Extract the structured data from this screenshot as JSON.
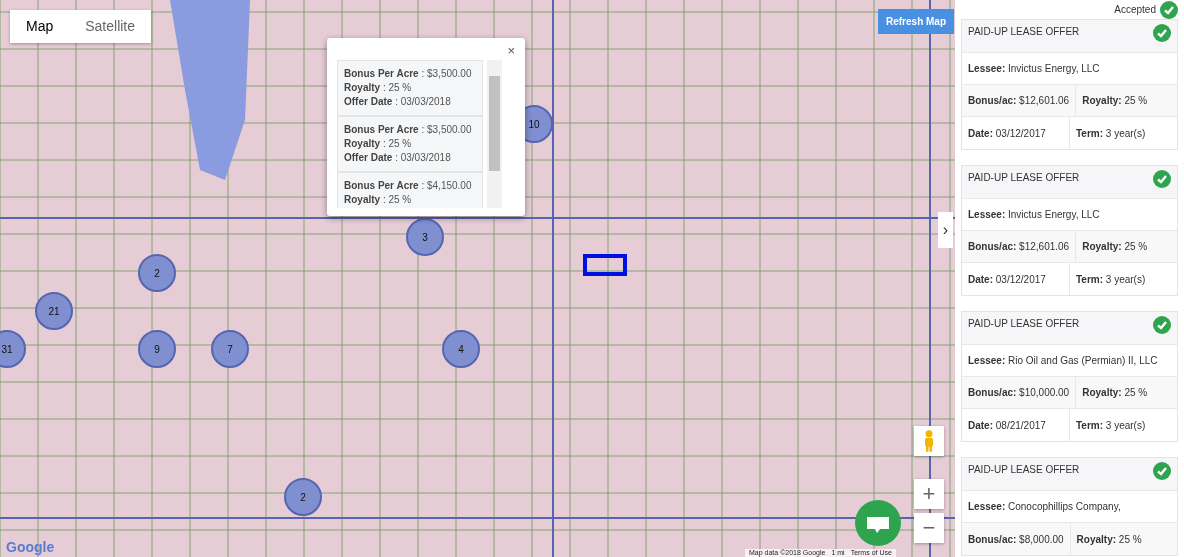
{
  "map": {
    "tabs": [
      {
        "label": "Map",
        "selected": true
      },
      {
        "label": "Satellite",
        "selected": false
      }
    ],
    "refresh_button": "Refresh Map",
    "clusters": [
      "10",
      "3",
      "2",
      "21",
      "31",
      "9",
      "7",
      "4",
      "2"
    ],
    "popup": {
      "close": "×",
      "offers": [
        {
          "fields": [
            {
              "label": "Bonus Per Acre",
              "value": ": $3,500.00"
            },
            {
              "label": "Royalty",
              "value": ": 25 %"
            },
            {
              "label": "Offer Date",
              "value": ": 03/03/2018"
            }
          ]
        },
        {
          "fields": [
            {
              "label": "Bonus Per Acre",
              "value": ": $3,500.00"
            },
            {
              "label": "Royalty",
              "value": ": 25 %"
            },
            {
              "label": "Offer Date",
              "value": ": 03/03/2018"
            }
          ]
        },
        {
          "fields": [
            {
              "label": "Bonus Per Acre",
              "value": ": $4,150.00"
            },
            {
              "label": "Royalty",
              "value": ": 25 %"
            }
          ]
        }
      ]
    },
    "zoom_in": "+",
    "zoom_out": "−",
    "panel_toggle": "›",
    "logo": "Google",
    "attribution": "Map data ©2018 Google",
    "scale": "1 mi",
    "terms": "Terms of Use"
  },
  "panel": {
    "status": "Accepted",
    "cards": [
      {
        "title": "PAID-UP LEASE OFFER",
        "accepted": true,
        "rows": [
          [
            {
              "label": "Lessee:",
              "value": "Invictus Energy, LLC"
            }
          ],
          [
            {
              "label": "Bonus/ac:",
              "value": "$12,601.06"
            },
            {
              "label": "Royalty:",
              "value": "25 %"
            }
          ],
          [
            {
              "label": "Date:",
              "value": "03/12/2017"
            },
            {
              "label": "Term:",
              "value": "3 year(s)"
            }
          ]
        ]
      },
      {
        "title": "PAID-UP LEASE OFFER",
        "accepted": true,
        "rows": [
          [
            {
              "label": "Lessee:",
              "value": "Invictus Energy, LLC"
            }
          ],
          [
            {
              "label": "Bonus/ac:",
              "value": "$12,601.06"
            },
            {
              "label": "Royalty:",
              "value": "25 %"
            }
          ],
          [
            {
              "label": "Date:",
              "value": "03/12/2017"
            },
            {
              "label": "Term:",
              "value": "3 year(s)"
            }
          ]
        ]
      },
      {
        "title": "PAID-UP LEASE OFFER",
        "accepted": true,
        "rows": [
          [
            {
              "label": "Lessee:",
              "value": "Rio Oil and Gas (Permian) II, LLC"
            }
          ],
          [
            {
              "label": "Bonus/ac:",
              "value": "$10,000.00"
            },
            {
              "label": "Royalty:",
              "value": "25 %"
            }
          ],
          [
            {
              "label": "Date:",
              "value": "08/21/2017"
            },
            {
              "label": "Term:",
              "value": "3 year(s)"
            }
          ]
        ]
      },
      {
        "title": "PAID-UP LEASE OFFER",
        "accepted": true,
        "rows": [
          [
            {
              "label": "Lessee:",
              "value": "Conocophillips Company,"
            }
          ],
          [
            {
              "label": "Bonus/ac:",
              "value": "$8,000.00"
            },
            {
              "label": "Royalty:",
              "value": "25 %"
            }
          ]
        ]
      }
    ]
  }
}
